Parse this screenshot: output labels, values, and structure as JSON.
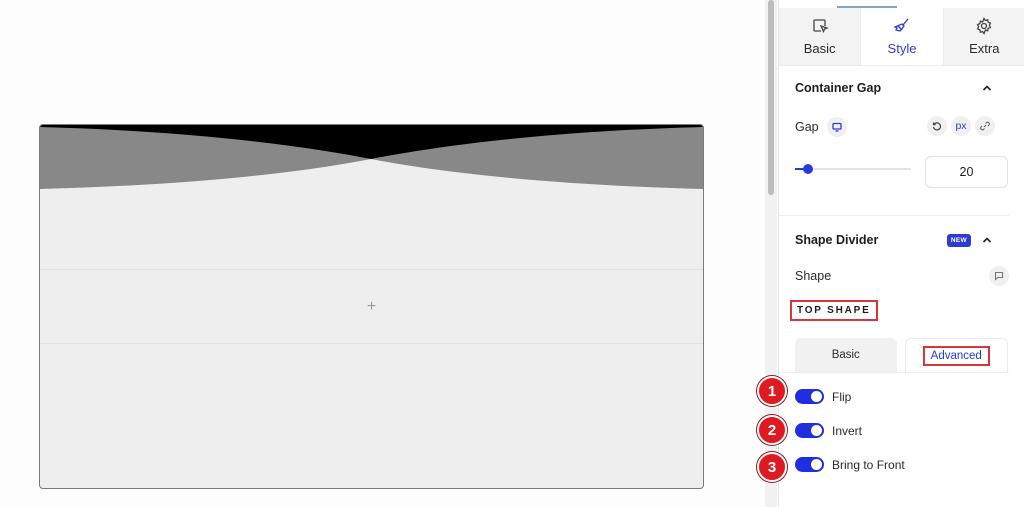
{
  "canvas": {
    "add_icon": "+"
  },
  "panel": {
    "tabs": [
      {
        "label": "Basic",
        "icon": "cursor-select-icon",
        "active": false
      },
      {
        "label": "Style",
        "icon": "paintbrush-icon",
        "active": true
      },
      {
        "label": "Extra",
        "icon": "gear-icon",
        "active": false
      }
    ],
    "container_gap": {
      "title": "Container Gap",
      "gap_label": "Gap",
      "unit": "px",
      "value": "20",
      "slider_value": 20
    },
    "shape_divider": {
      "title": "Shape Divider",
      "badge": "NEW",
      "shape_label": "Shape",
      "section_label": "TOP SHAPE",
      "subtabs": [
        {
          "label": "Basic",
          "active": false
        },
        {
          "label": "Advanced",
          "active": true
        }
      ],
      "toggles": [
        {
          "label": "Flip",
          "on": true,
          "step": "1"
        },
        {
          "label": "Invert",
          "on": true,
          "step": "2"
        },
        {
          "label": "Bring to Front",
          "on": true,
          "step": "3"
        }
      ]
    }
  },
  "colors": {
    "accent": "#2c3bd6",
    "annotation": "#e01a22",
    "shape_dark": "#000000",
    "shape_mid": "#888888",
    "container_bg": "#eeeeee"
  }
}
